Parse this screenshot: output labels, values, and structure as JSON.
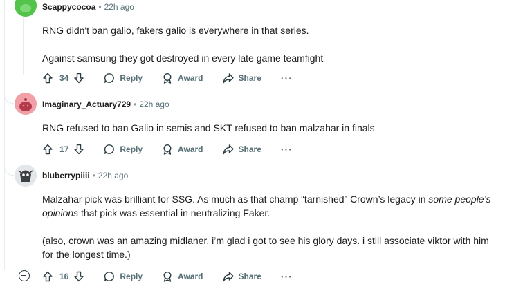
{
  "comments": [
    {
      "author": "Scappycocoa",
      "time": "22h ago",
      "paragraphs": [
        "RNG didn't ban galio, fakers galio is everywhere in that series.",
        "Against samsung they got destroyed in every late game teamfight"
      ],
      "votes": "34",
      "avatar_color": "#54c34b"
    },
    {
      "author": "Imaginary_Actuary729",
      "time": "22h ago",
      "paragraphs": [
        "RNG refused to ban Galio in semis and SKT refused to ban malzahar in finals"
      ],
      "votes": "17",
      "avatar_color": "#f2a0a8"
    },
    {
      "author": "bluberrypiiii",
      "time": "22h ago",
      "paragraph1_before": "Malzahar pick was brilliant for SSG. As much as that champ “tarnished” Crown’s legacy in ",
      "paragraph1_italic": "some people’s opinions",
      "paragraph1_after": " that pick was essential in neutralizing Faker.",
      "paragraph2": "(also, crown was an amazing midlaner. i’m glad i got to see his glory days. i still associate viktor with him for the longest time.)",
      "votes": "16",
      "avatar_color": "#d9dde0"
    }
  ],
  "actions": {
    "reply": "Reply",
    "award": "Award",
    "share": "Share",
    "more": "···"
  },
  "separator": "•"
}
